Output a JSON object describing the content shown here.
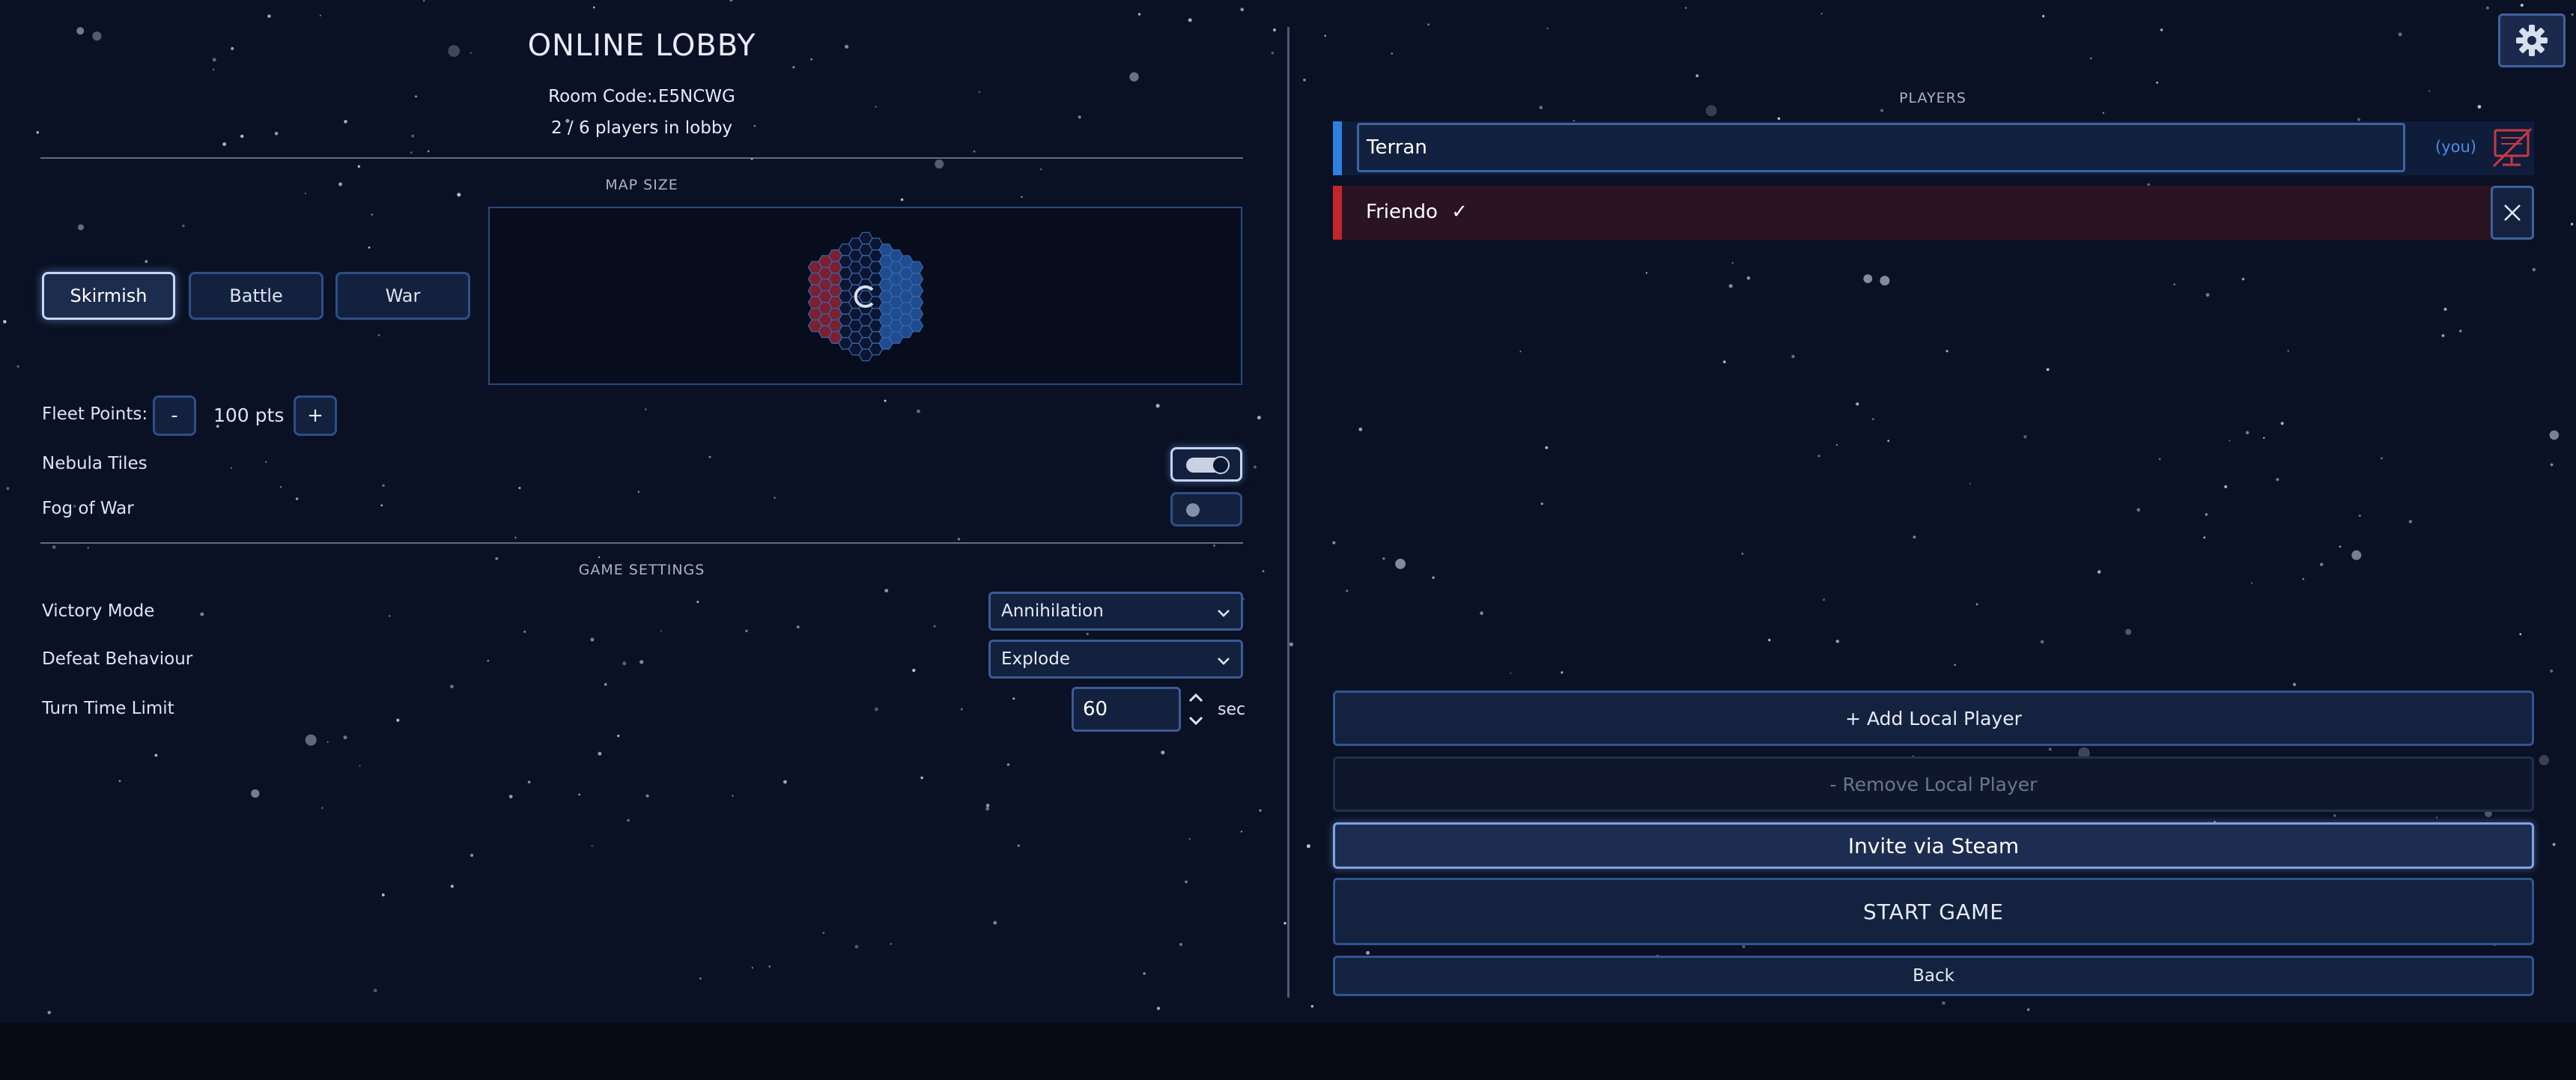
{
  "lobby": {
    "title": "ONLINE LOBBY",
    "room_code": "Room Code: E5NCWG",
    "player_count": "2 / 6 players in lobby"
  },
  "map_size": {
    "label": "MAP SIZE",
    "options": [
      "Skirmish",
      "Battle",
      "War"
    ],
    "selected": "Skirmish"
  },
  "fleet_points": {
    "label": "Fleet Points:",
    "minus": "-",
    "value": "100 pts",
    "plus": "+"
  },
  "nebula_tiles": {
    "label": "Nebula Tiles",
    "enabled": true
  },
  "fog_of_war": {
    "label": "Fog of War",
    "enabled": false
  },
  "game_settings": {
    "label": "GAME SETTINGS",
    "victory_mode": {
      "label": "Victory Mode",
      "value": "Annihilation"
    },
    "defeat_behaviour": {
      "label": "Defeat Behaviour",
      "value": "Explode"
    },
    "turn_time_limit": {
      "label": "Turn Time Limit",
      "value": "60",
      "unit": "sec"
    }
  },
  "players": {
    "label": "PLAYERS",
    "list": [
      {
        "name": "Terran",
        "tag": "(you)",
        "color": "#2f7fe0",
        "row_bg": "#0f1d3a"
      },
      {
        "name": "Friendo",
        "check": "✓",
        "color": "#c1262c",
        "row_bg": "#2a1424"
      }
    ]
  },
  "actions": {
    "add_local": "+ Add Local Player",
    "remove_local": "- Remove Local Player",
    "invite": "Invite via Steam",
    "start": "START GAME",
    "back": "Back"
  },
  "icons": {
    "settings": "gear-icon",
    "remove_player": "close-icon",
    "no_controller": "no-controller-icon",
    "dropdown": "chevron-down-icon",
    "spinner": "spinner-arrows-icon",
    "map_loading": "loading-spinner-icon"
  },
  "colors": {
    "background": "#0b1124",
    "accent": "#2f5592",
    "hex_red": "#7b2030",
    "hex_blue": "#1f4c8f"
  }
}
